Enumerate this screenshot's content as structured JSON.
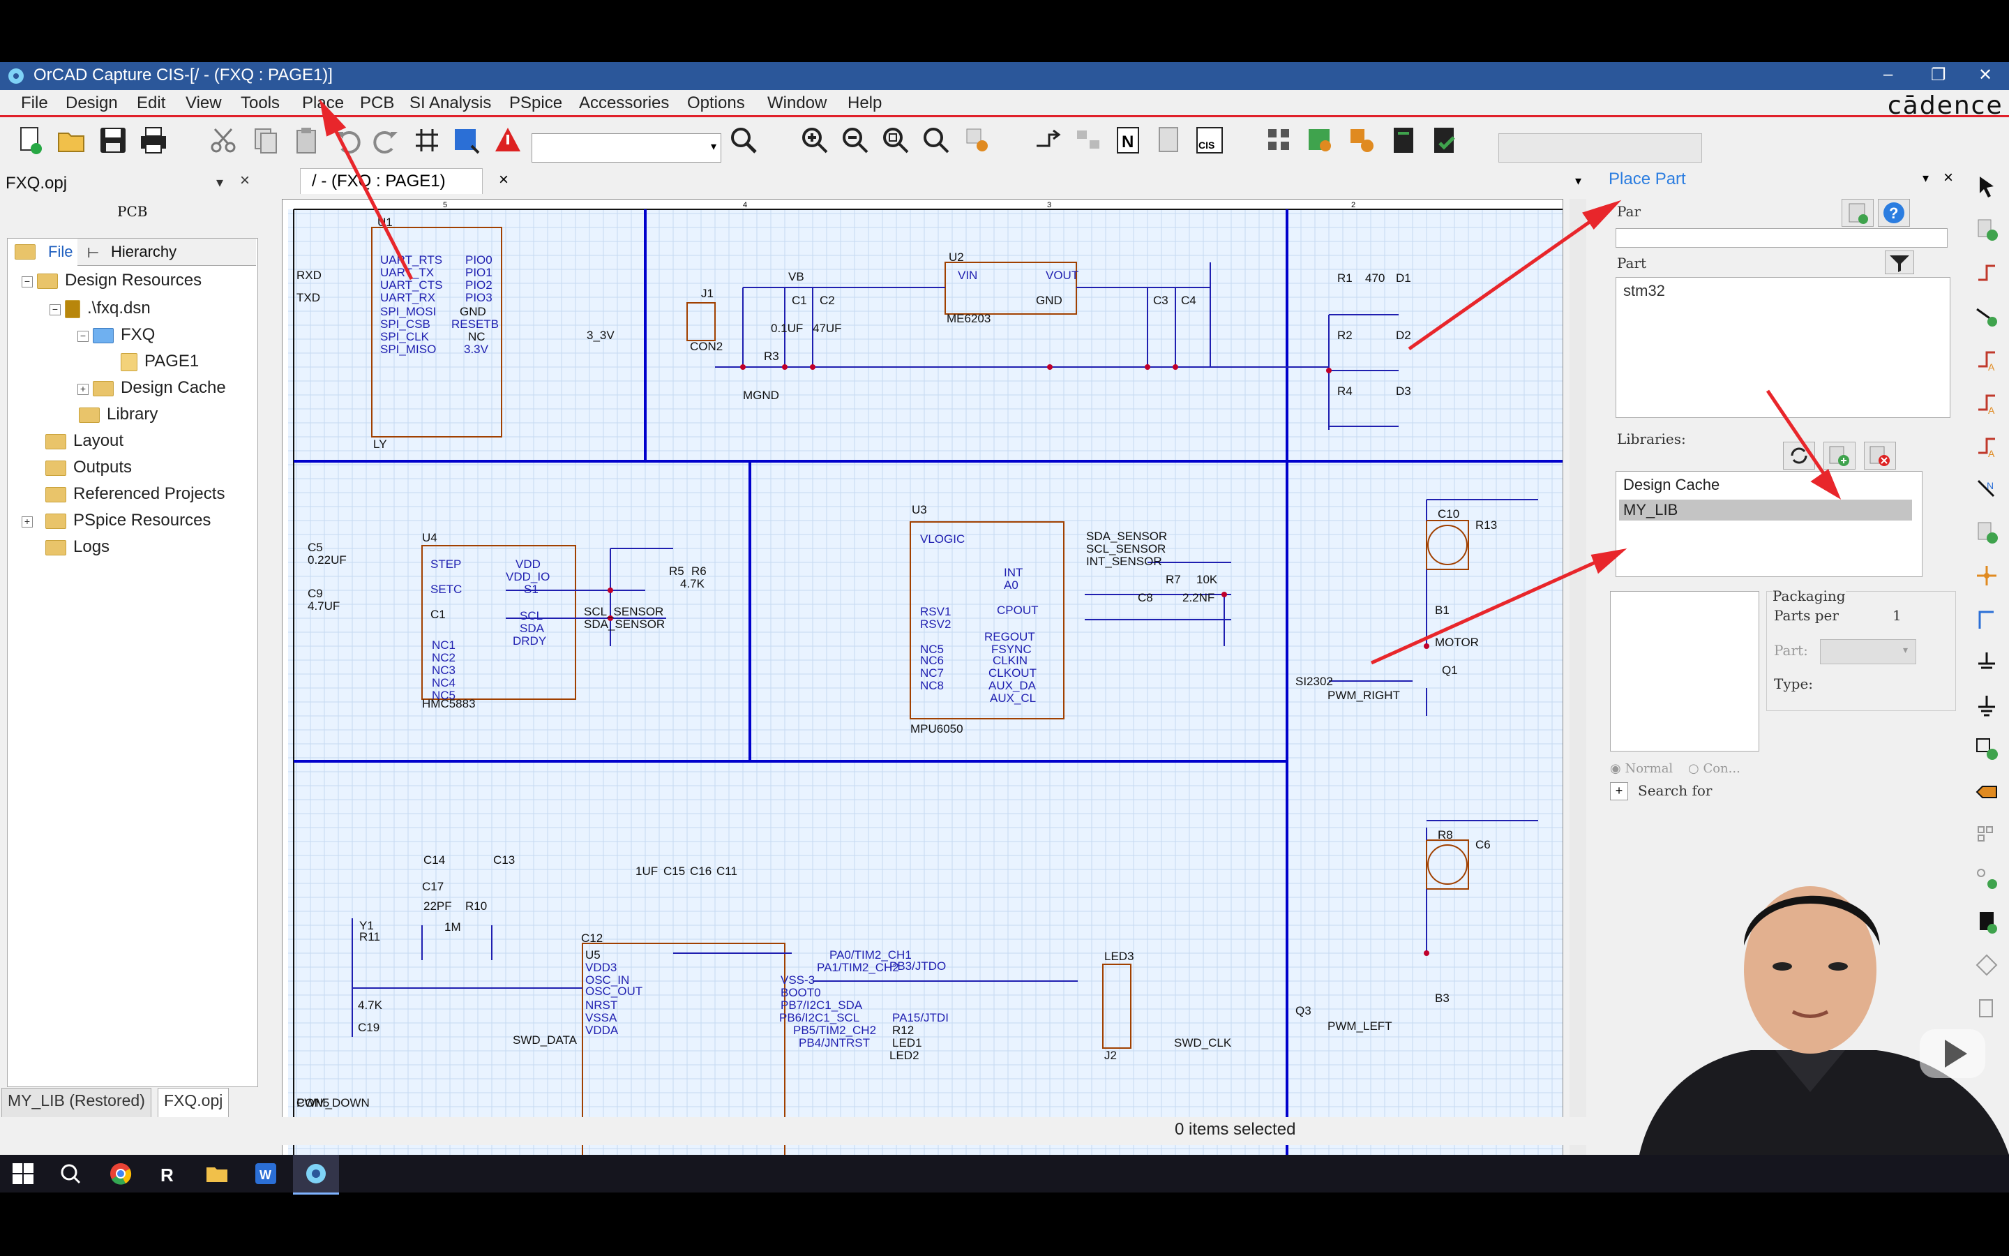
{
  "window": {
    "title": "OrCAD Capture CIS-[/ - (FXQ : PAGE1)]",
    "brand": "cādence",
    "minimize": "–",
    "restore": "❐",
    "close": "✕"
  },
  "menu": [
    "File",
    "Design",
    "Edit",
    "View",
    "Tools",
    "Place",
    "PCB",
    "SI Analysis",
    "PSpice",
    "Accessories",
    "Options",
    "Window",
    "Help"
  ],
  "left_panel": {
    "title": "FXQ.opj",
    "pcb_label": "PCB",
    "tabs": {
      "file": "File",
      "hierarchy": "Hierarchy"
    },
    "tree": {
      "design_resources": "Design Resources",
      "dsn": ".\\fxq.dsn",
      "fxq": "FXQ",
      "page1": "PAGE1",
      "design_cache": "Design Cache",
      "library": "Library",
      "layout": "Layout",
      "outputs": "Outputs",
      "referenced_projects": "Referenced Projects",
      "pspice_resources": "PSpice Resources",
      "logs": "Logs"
    },
    "bottom_tabs": [
      "MY_LIB (Restored)",
      "FXQ.opj"
    ]
  },
  "document_tab": "/ - (FXQ : PAGE1)",
  "status": "0 items selected",
  "place_part": {
    "title": "Place Part",
    "part_label": "Part",
    "part_value": "stm32",
    "par_label": "Par",
    "libraries_label": "Libraries:",
    "libraries": [
      "Design Cache",
      "MY_LIB"
    ],
    "packaging_label": "Packaging",
    "parts_per": "Parts per",
    "parts_per_value": "1",
    "part_field": "Part:",
    "type_field": "Type:",
    "normal": "Normal",
    "convert": "Con...",
    "search_for": "Search for"
  },
  "schematic": {
    "border_numbers": [
      "5",
      "4",
      "3",
      "2"
    ],
    "labels": [
      "U1",
      "UART_RTS",
      "UART_TX",
      "UART_CTS",
      "UART_RX",
      "SPI_MOSI",
      "SPI_CSB",
      "SPI_CLK",
      "SPI_MISO",
      "PIO0",
      "PIO1",
      "PIO2",
      "PIO3",
      "GND",
      "RESETB",
      "NC",
      "3.3V",
      "LY",
      "RXD",
      "TXD",
      "3_3V",
      "U2",
      "VIN",
      "VOUT",
      "GND",
      "ME6203",
      "VB",
      "C1",
      "C2",
      "C3",
      "C4",
      "0.1UF",
      "47UF",
      "J1",
      "CON2",
      "R3",
      "MGND",
      "R1",
      "R2",
      "R4",
      "470",
      "D1",
      "D2",
      "D3",
      "U4",
      "STEP",
      "SETC",
      "C1",
      "VDD",
      "VDD_IO",
      "S1",
      "SCL",
      "SDA",
      "DRDY",
      "NC1",
      "NC2",
      "NC3",
      "NC4",
      "NC5",
      "HMC5883",
      "C5",
      "0.22UF",
      "C9",
      "4.7UF",
      "R5",
      "R6",
      "4.7K",
      "SCL_SENSOR",
      "SDA_SENSOR",
      "U3",
      "VLOGIC",
      "RSV1",
      "RSV2",
      "NC5",
      "NC6",
      "NC7",
      "NC8",
      "CPOUT",
      "REGOUT",
      "FSYNC",
      "CLKIN",
      "CLKOUT",
      "AUX_DA",
      "AUX_CL",
      "INT",
      "A0",
      "MPU6050",
      "SDA_SENSOR",
      "SCL_SENSOR",
      "INT_SENSOR",
      "R7",
      "10K",
      "C8",
      "2.2NF",
      "C10",
      "B1",
      "MOTOR",
      "Q1",
      "SI2302",
      "PWM_RIGHT",
      "R8",
      "B3",
      "Q3",
      "PWM_LEFT",
      "R13",
      "C6",
      "C14",
      "C13",
      "C17",
      "22PF",
      "R10",
      "1M",
      "Y1",
      "R11",
      "4.7K",
      "C19",
      "1UF",
      "C15",
      "C16",
      "C11",
      "C12",
      "U5",
      "VDD3",
      "OSC_IN",
      "OSC_OUT",
      "NRST",
      "VSSA",
      "VDDA",
      "PA0/TIM2_CH1",
      "PA1/TIM2_CH2",
      "VSS-3",
      "BOOT0",
      "PB7/I2C1_SDA",
      "PB6/I2C1_SCL",
      "PB5/TIM2_CH2",
      "PB4/JNTRST",
      "PB3/JTDO",
      "PA15/JTDI",
      "R12",
      "LED1",
      "LED2",
      "LED3",
      "SWD_CLK",
      "J2",
      "SWD_DATA",
      "CON5",
      "PWM_DOWN"
    ]
  },
  "colors": {
    "title_bar": "#2b579a",
    "wire": "#1f1fb0",
    "part": "#a04000",
    "net_label": "#111111",
    "grid": "#c5daf2",
    "sheet_border": "#0000cc",
    "annotation_arrow": "#e8262b"
  }
}
